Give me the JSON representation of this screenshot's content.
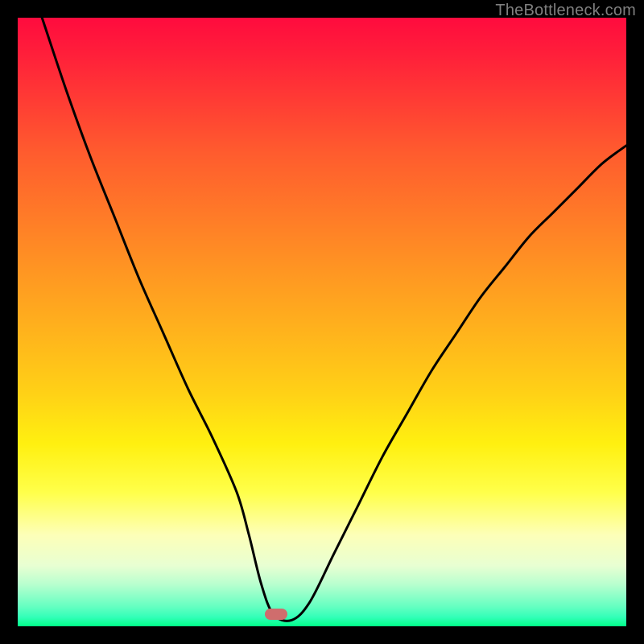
{
  "watermark": "TheBottleneck.com",
  "marker": {
    "x_pct": 42.5,
    "y_pct": 98.0,
    "color": "#cf6d6d"
  },
  "chart_data": {
    "type": "line",
    "title": "",
    "xlabel": "",
    "ylabel": "",
    "xlim": [
      0,
      100
    ],
    "ylim": [
      0,
      100
    ],
    "grid": false,
    "series": [
      {
        "name": "bottleneck-curve",
        "x": [
          4,
          8,
          12,
          16,
          20,
          24,
          28,
          32,
          36,
          38,
          40,
          42,
          45,
          48,
          52,
          56,
          60,
          64,
          68,
          72,
          76,
          80,
          84,
          88,
          92,
          96,
          100
        ],
        "values": [
          100,
          88,
          77,
          67,
          57,
          48,
          39,
          31,
          22,
          15,
          7,
          2,
          1,
          4,
          12,
          20,
          28,
          35,
          42,
          48,
          54,
          59,
          64,
          68,
          72,
          76,
          79
        ]
      }
    ],
    "background_gradient": {
      "top_color": "#ff0b3e",
      "mid_color": "#fff010",
      "bottom_color": "#00ff88"
    }
  }
}
